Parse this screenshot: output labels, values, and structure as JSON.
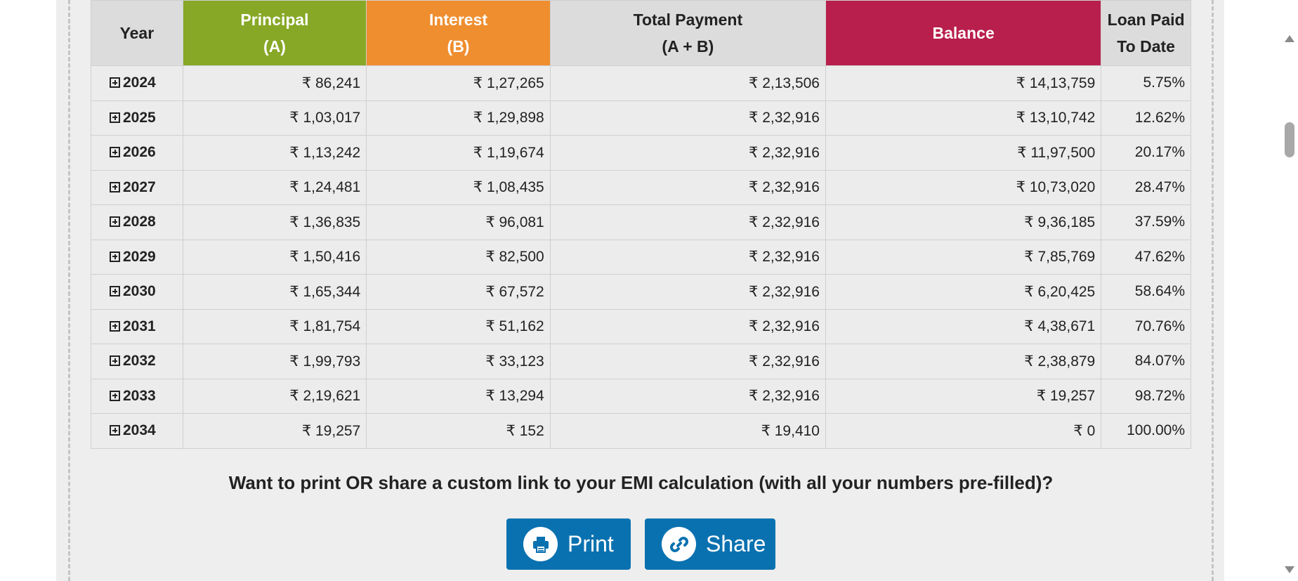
{
  "table": {
    "headers": {
      "year": "Year",
      "principal": [
        "Principal",
        "(A)"
      ],
      "interest": [
        "Interest",
        "(B)"
      ],
      "total": [
        "Total Payment",
        "(A + B)"
      ],
      "balance": "Balance",
      "paid": [
        "Loan Paid",
        "To Date"
      ]
    },
    "rows": [
      {
        "year": "2024",
        "principal": "₹ 86,241",
        "interest": "₹ 1,27,265",
        "total": "₹ 2,13,506",
        "balance": "₹ 14,13,759",
        "paid": "5.75%"
      },
      {
        "year": "2025",
        "principal": "₹ 1,03,017",
        "interest": "₹ 1,29,898",
        "total": "₹ 2,32,916",
        "balance": "₹ 13,10,742",
        "paid": "12.62%"
      },
      {
        "year": "2026",
        "principal": "₹ 1,13,242",
        "interest": "₹ 1,19,674",
        "total": "₹ 2,32,916",
        "balance": "₹ 11,97,500",
        "paid": "20.17%"
      },
      {
        "year": "2027",
        "principal": "₹ 1,24,481",
        "interest": "₹ 1,08,435",
        "total": "₹ 2,32,916",
        "balance": "₹ 10,73,020",
        "paid": "28.47%"
      },
      {
        "year": "2028",
        "principal": "₹ 1,36,835",
        "interest": "₹ 96,081",
        "total": "₹ 2,32,916",
        "balance": "₹ 9,36,185",
        "paid": "37.59%"
      },
      {
        "year": "2029",
        "principal": "₹ 1,50,416",
        "interest": "₹ 82,500",
        "total": "₹ 2,32,916",
        "balance": "₹ 7,85,769",
        "paid": "47.62%"
      },
      {
        "year": "2030",
        "principal": "₹ 1,65,344",
        "interest": "₹ 67,572",
        "total": "₹ 2,32,916",
        "balance": "₹ 6,20,425",
        "paid": "58.64%"
      },
      {
        "year": "2031",
        "principal": "₹ 1,81,754",
        "interest": "₹ 51,162",
        "total": "₹ 2,32,916",
        "balance": "₹ 4,38,671",
        "paid": "70.76%"
      },
      {
        "year": "2032",
        "principal": "₹ 1,99,793",
        "interest": "₹ 33,123",
        "total": "₹ 2,32,916",
        "balance": "₹ 2,38,879",
        "paid": "84.07%"
      },
      {
        "year": "2033",
        "principal": "₹ 2,19,621",
        "interest": "₹ 13,294",
        "total": "₹ 2,32,916",
        "balance": "₹ 19,257",
        "paid": "98.72%"
      },
      {
        "year": "2034",
        "principal": "₹ 19,257",
        "interest": "₹ 152",
        "total": "₹ 19,410",
        "balance": "₹ 0",
        "paid": "100.00%"
      }
    ]
  },
  "cta": {
    "text": "Want to print OR share a custom link to your EMI calculation (with all your numbers pre-filled)?",
    "print_label": "Print",
    "share_label": "Share"
  },
  "icons": {
    "expand": "plus-square-icon",
    "print": "printer-icon",
    "share": "link-icon"
  },
  "colors": {
    "principal": "#87a826",
    "interest": "#ef8e2f",
    "balance": "#b81f4c",
    "button": "#0a71b0"
  }
}
